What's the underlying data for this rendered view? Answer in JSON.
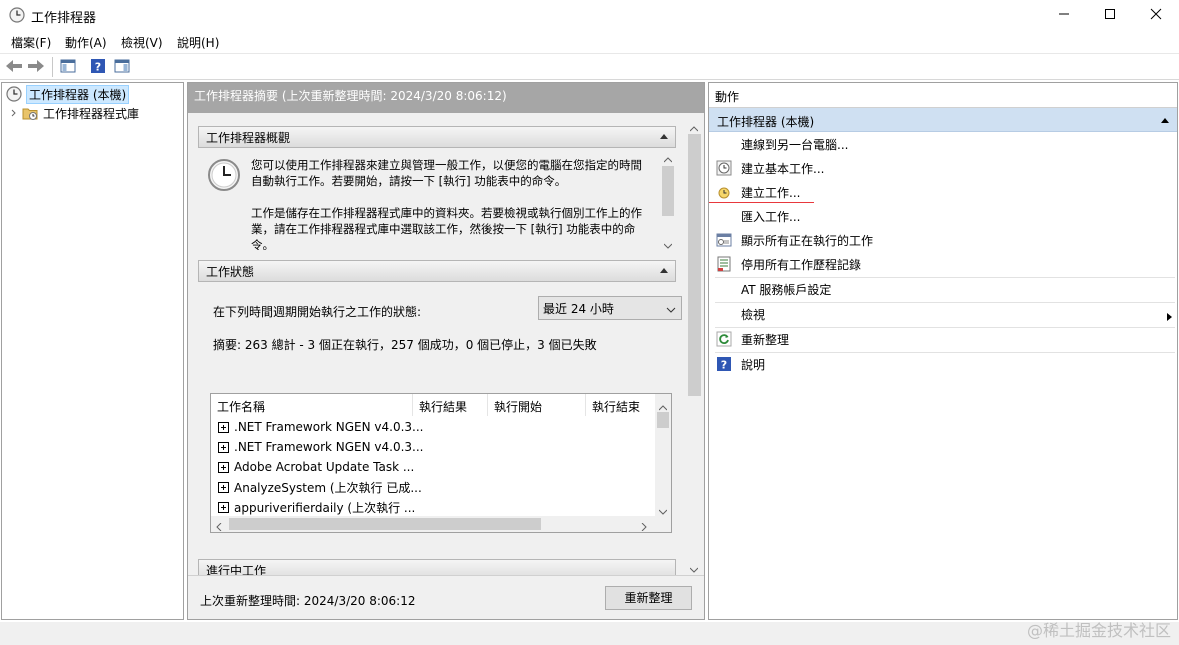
{
  "window": {
    "title": "工作排程器",
    "controls": {
      "minimize": "minimize-icon",
      "maximize": "maximize-icon",
      "close": "close-icon"
    }
  },
  "menu": [
    "檔案(F)",
    "動作(A)",
    "檢視(V)",
    "說明(H)"
  ],
  "toolbar": {
    "icons": [
      "back-arrow-icon",
      "forward-arrow-icon",
      "show-hide-tree-icon",
      "help-icon",
      "show-hide-action-pane-icon"
    ]
  },
  "tree": {
    "root": "工作排程器 (本機)",
    "child": "工作排程器程式庫"
  },
  "center": {
    "header": "工作排程器摘要 (上次重新整理時間: 2024/3/20 8:06:12)",
    "overview": {
      "title": "工作排程器概觀",
      "paragraph1": "您可以使用工作排程器來建立與管理一般工作，以便您的電腦在您指定的時間自動執行工作。若要開始，請按一下 [執行] 功能表中的命令。",
      "paragraph2": "工作是儲存在工作排程器程式庫中的資料夾。若要檢視或執行個別工作上的作業，請在工作排程器程式庫中選取該工作，然後按一下 [執行] 功能表中的命令。"
    },
    "status": {
      "title": "工作狀態",
      "period_label": "在下列時間週期開始執行之工作的狀態:",
      "period_value": "最近 24 小時",
      "summary": "摘要: 263 總計 - 3 個正在執行，257 個成功，0 個已停止，3 個已失敗"
    },
    "table": {
      "columns": [
        "工作名稱",
        "執行結果",
        "執行開始",
        "執行結束"
      ],
      "rows": [
        ".NET Framework NGEN v4.0.3...",
        ".NET Framework NGEN v4.0.3...",
        "Adobe Acrobat Update Task ...",
        "AnalyzeSystem (上次執行 已成...",
        "appuriverifierdaily (上次執行 ..."
      ]
    },
    "running": {
      "title": "進行中工作"
    },
    "footer": {
      "last_refresh": "上次重新整理時間: 2024/3/20 8:06:12",
      "refresh_button": "重新整理"
    }
  },
  "actions": {
    "title": "動作",
    "group": "工作排程器 (本機)",
    "items": [
      {
        "label": "連線到另一台電腦...",
        "icon": ""
      },
      {
        "label": "建立基本工作...",
        "icon": "basic-task-icon"
      },
      {
        "label": "建立工作...",
        "icon": "create-task-icon"
      },
      {
        "label": "匯入工作...",
        "icon": ""
      },
      {
        "label": "顯示所有正在執行的工作",
        "icon": "running-tasks-icon"
      },
      {
        "label": "停用所有工作歷程記錄",
        "icon": "history-icon"
      },
      {
        "label": "AT 服務帳戶設定",
        "icon": ""
      },
      {
        "label": "檢視",
        "icon": ""
      },
      {
        "label": "重新整理",
        "icon": "refresh-icon"
      },
      {
        "label": "說明",
        "icon": "help-icon"
      }
    ],
    "accent_underline_color": "#e8383d"
  },
  "watermark": "@稀土掘金技术社区"
}
